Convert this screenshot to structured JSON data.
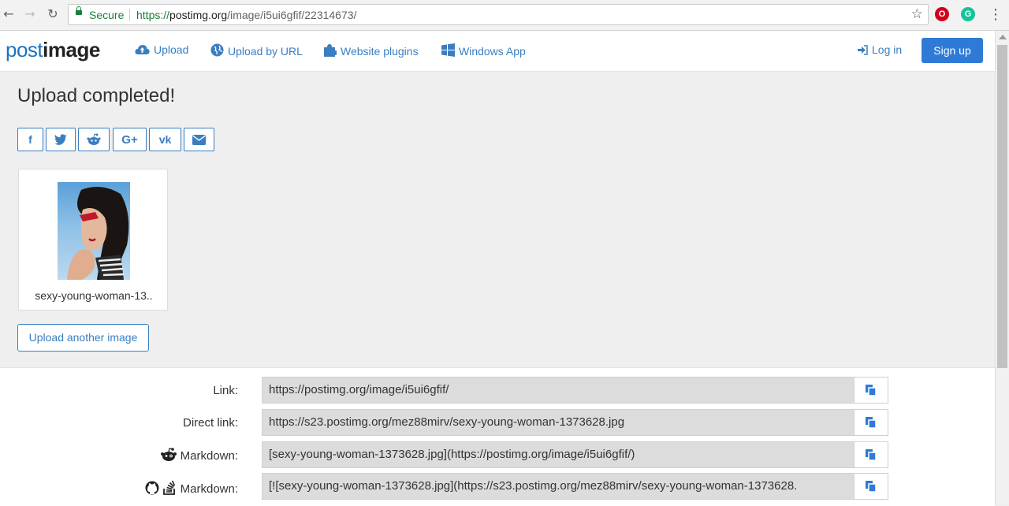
{
  "browser": {
    "secure_label": "Secure",
    "url_scheme": "https://",
    "url_host": "postimg.org",
    "url_path": "/image/i5ui6gfif/22314673/"
  },
  "header": {
    "logo_part1": "post",
    "logo_part2": "image",
    "nav": {
      "upload": "Upload",
      "upload_url": "Upload by URL",
      "plugins": "Website plugins",
      "windows_app": "Windows App"
    },
    "login": "Log in",
    "signup": "Sign up"
  },
  "main": {
    "title": "Upload completed!",
    "share_icons": [
      "facebook-icon",
      "twitter-icon",
      "reddit-icon",
      "google-plus-icon",
      "vk-icon",
      "email-icon"
    ],
    "thumbnail_name": "sexy-young-woman-13..",
    "upload_another": "Upload another image"
  },
  "links": [
    {
      "label": "Link:",
      "value": "https://postimg.org/image/i5ui6gfif/"
    },
    {
      "label": "Direct link:",
      "value": "https://s23.postimg.org/mez88mirv/sexy-young-woman-1373628.jpg"
    },
    {
      "label": "Markdown:",
      "value": "[sexy-young-woman-1373628.jpg](https://postimg.org/image/i5ui6gfif/)"
    },
    {
      "label": "Markdown:",
      "value": "[![sexy-young-woman-1373628.jpg](https://s23.postimg.org/mez88mirv/sexy-young-woman-1373628."
    }
  ],
  "colors": {
    "accent": "#3a7ec1",
    "signup_bg": "#2f7ad6",
    "secure_green": "#188038"
  }
}
